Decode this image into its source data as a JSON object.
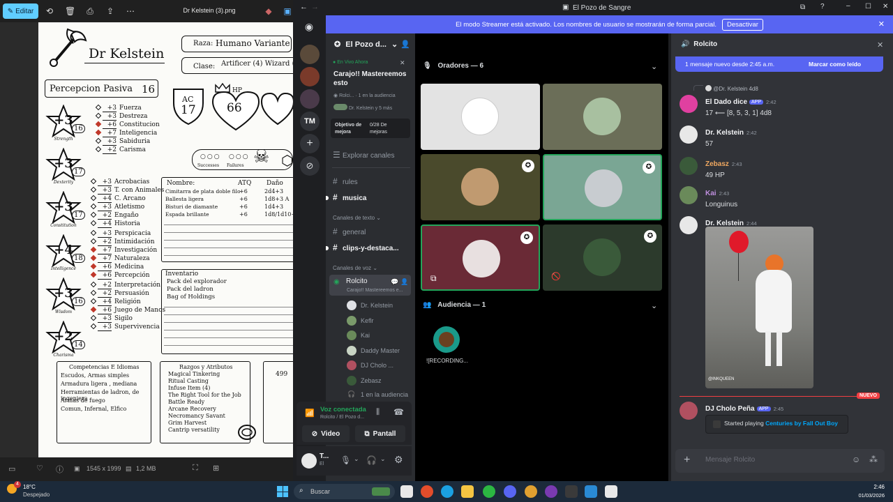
{
  "viewer": {
    "edit_label": "Editar",
    "file_name": "Dr Kelstein (3).png",
    "dimensions": "1545 x 1999",
    "size": "1,2 MB"
  },
  "sheet": {
    "name": "Dr Kelstein",
    "race_label": "Raza:",
    "race": "Humano Variante",
    "class_label": "Clase:",
    "class": "Artificer (4) Wizard (4)",
    "passive_label": "Percepcion Pasiva",
    "passive_value": "16",
    "ac_label": "AC",
    "ac_value": "17",
    "hp_label": "HP",
    "hp_value": "66",
    "successes": "Successes",
    "failures": "Failures",
    "abilities": [
      {
        "mod": "+3",
        "score": "16",
        "name": "Strength"
      },
      {
        "mod": "+3",
        "score": "17",
        "name": "Dexterity"
      },
      {
        "mod": "+3",
        "score": "17",
        "name": "Constitution"
      },
      {
        "mod": "+4",
        "score": "18",
        "name": "Intelligence"
      },
      {
        "mod": "+3",
        "score": "16",
        "name": "Wisdom"
      },
      {
        "mod": "+2",
        "score": "14",
        "name": "Charisma"
      }
    ],
    "saves": [
      {
        "v": "+3",
        "n": "Fuerza",
        "p": false
      },
      {
        "v": "+3",
        "n": "Destreza",
        "p": false
      },
      {
        "v": "+6",
        "n": "Constitucion",
        "p": true
      },
      {
        "v": "+7",
        "n": "Inteligencia",
        "p": true
      },
      {
        "v": "+3",
        "n": "Sabiduria",
        "p": false
      },
      {
        "v": "+2",
        "n": "Carisma",
        "p": false
      }
    ],
    "skills": [
      {
        "v": "+3",
        "n": "Acrobacias",
        "p": false
      },
      {
        "v": "+3",
        "n": "T. con Animales",
        "p": false
      },
      {
        "v": "+4",
        "n": "C. Arcano",
        "p": false
      },
      {
        "v": "+3",
        "n": "Atletismo",
        "p": false
      },
      {
        "v": "+2",
        "n": "Engaño",
        "p": false
      },
      {
        "v": "+4",
        "n": "Historia",
        "p": false
      },
      {
        "v": "+3",
        "n": "Perspicacia",
        "p": false
      },
      {
        "v": "+2",
        "n": "Intimidación",
        "p": false
      },
      {
        "v": "+7",
        "n": "Investigación",
        "p": true
      },
      {
        "v": "+7",
        "n": "Naturaleza",
        "p": true
      },
      {
        "v": "+6",
        "n": "Medicina",
        "p": true
      },
      {
        "v": "+6",
        "n": "Percepción",
        "p": true
      },
      {
        "v": "+2",
        "n": "Interpretación",
        "p": false
      },
      {
        "v": "+2",
        "n": "Persuasión",
        "p": false
      },
      {
        "v": "+4",
        "n": "Religión",
        "p": false
      },
      {
        "v": "+6",
        "n": "Juego de Manos",
        "p": true
      },
      {
        "v": "+3",
        "n": "Sigilo",
        "p": false
      },
      {
        "v": "+3",
        "n": "Supervivencia",
        "p": false
      }
    ],
    "attack_headers": [
      "Nombre:",
      "ATQ",
      "Daño"
    ],
    "attacks": [
      {
        "n": "Cimitarra de plata doble filo",
        "a": "+6",
        "d": "2d4+3"
      },
      {
        "n": "Ballesta ligera",
        "a": "+6",
        "d": "1d8+3 A"
      },
      {
        "n": "Bisturi de diamante",
        "a": "+6",
        "d": "1d4+3"
      },
      {
        "n": "Espada brillante",
        "a": "+6",
        "d": "1d8/1d10+"
      }
    ],
    "inventory_title": "Inventario",
    "inventory": [
      "Pack del explorador",
      "Pack del ladron",
      "Bag of Holdings"
    ],
    "prof_title": "Competencias E Idiomas",
    "profs": [
      "Escudos, Armas simples",
      "Armadura ligera , mediana",
      "Herramientas de ladron, de ingeniera",
      "Armas de fuego",
      "Comun, Infernal, Elfico"
    ],
    "traits_title": "Razgos y Atributos",
    "traits": [
      "Magical Tinkering",
      "Ritual Casting",
      "Infuse Item (4)",
      "The Right Tool for the Job",
      "Battle Ready",
      "Arcane Recovery",
      "Necromancy Savant",
      "Grim Harvest",
      "Cantrip versatility"
    ],
    "extra": "499"
  },
  "discord": {
    "window_title": "El Pozo de Sangre",
    "banner_text": "El modo Streamer está activado. Los nombres de usuario se mostrarán de forma parcial.",
    "banner_button": "Desactivar",
    "rail_tm": "TM",
    "server_name": "El Pozo d...",
    "live_label": "En Vivo Ahora",
    "event_title": "Carajo!! Mastereemos esto",
    "event_sub": "Rolci... · 1 en la audiencia",
    "event_people": "Dr. Kelstein y 5 más",
    "boost_label": "Objetivo de mejora",
    "boost_value": "0/28 De mejoras",
    "explore": "Explorar canales",
    "ch_rules": "rules",
    "ch_musica": "musica",
    "cat_text": "Canales de texto",
    "ch_general": "general",
    "ch_clips": "clips-y-destaca...",
    "cat_voice": "Canales de voz",
    "voice_channel": "Rolcito",
    "voice_sub": "Carajo!! Mastereemos e...",
    "voice_users": [
      {
        "name": "Dr. Kelstein",
        "color": "#dfe1e5"
      },
      {
        "name": "Keflr",
        "color": "#7a9a6a"
      },
      {
        "name": "Kai",
        "color": "#6a8a5a"
      },
      {
        "name": "Daddy Master",
        "color": "#c8d4c4"
      },
      {
        "name": "DJ Cholo ...",
        "color": "#b05060"
      },
      {
        "name": "Zebasz",
        "color": "#3a5a3a"
      }
    ],
    "audience_count_label": "1 en la audiencia",
    "voice_connected": "Voz conectada",
    "voice_connected_sub": "Rolcito / El Pozo d...",
    "video_btn": "Video",
    "screen_btn": "Pantall",
    "user_short": "T...",
    "user_status": "El",
    "speakers_header": "Oradores — 6",
    "audience_header": "Audiencia — 1",
    "audience_member": "![RECORDING...",
    "chat_channel": "Rolcito",
    "new_messages": "1 mensaje nuevo desde 2:45 a.m.",
    "mark_read": "Marcar como leído",
    "reply_ref": "@Dr. Kelstein 4d8",
    "messages": [
      {
        "author": "El Dado dice",
        "app": "APP",
        "time": "2:42",
        "text": "17  ⟵ [8, 5, 3, 1] 4d8",
        "color": "#f2f3f5"
      },
      {
        "author": "Dr. Kelstein",
        "app": "",
        "time": "2:42",
        "text": "57",
        "color": "#f2f3f5"
      },
      {
        "author": "Zebasz",
        "app": "",
        "time": "2:43",
        "text": "49 HP",
        "color": "#f0a860"
      },
      {
        "author": "Kai",
        "app": "",
        "time": "2:43",
        "text": "Longuinus",
        "color": "#c090e0"
      },
      {
        "author": "Dr. Kelstein",
        "app": "",
        "time": "2:44",
        "text": "",
        "color": "#f2f3f5"
      },
      {
        "author": "DJ Cholo Peña",
        "app": "APP",
        "time": "2:45",
        "text": "",
        "color": "#f2f3f5"
      }
    ],
    "image_caption": "@INKQUEEN",
    "new_label": "NUEVO",
    "playing_prefix": "Started playing",
    "playing_song": "Centuries by Fall Out Boy",
    "input_placeholder": "Mensaje Rolcito",
    "brand_color": "#5865f2"
  },
  "taskbar": {
    "temp": "18°C",
    "weather": "Despejado",
    "search": "Buscar",
    "time": "2:46",
    "date": "01/03/2026",
    "notif_count": "4"
  }
}
